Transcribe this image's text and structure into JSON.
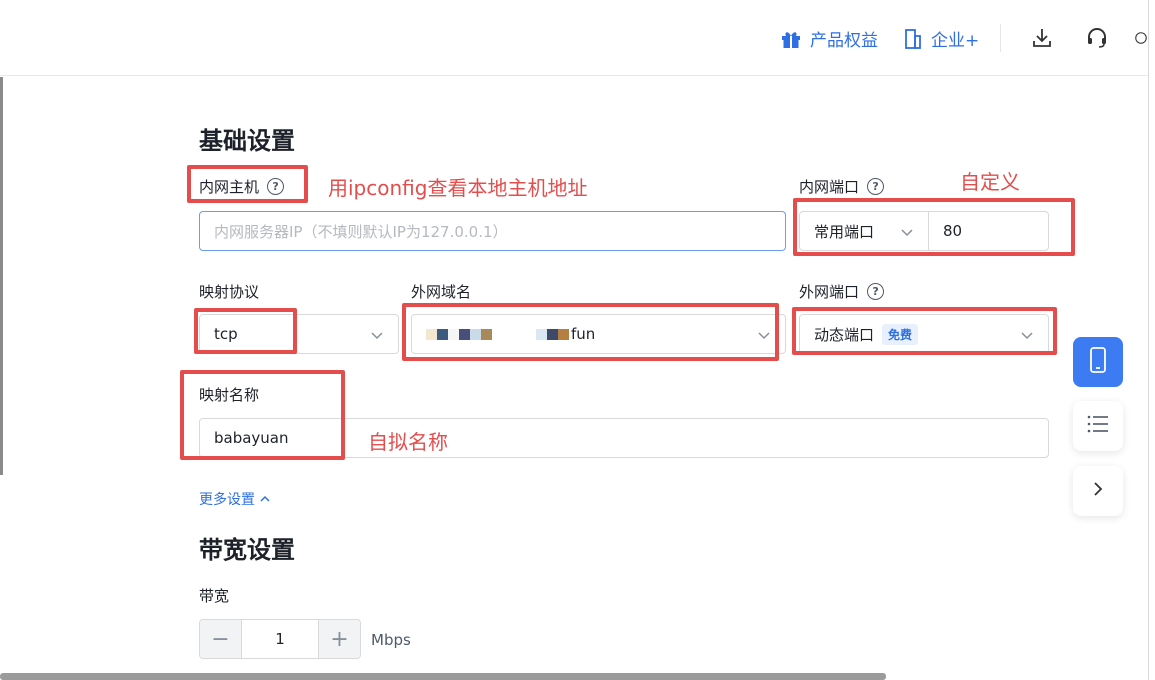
{
  "topbar": {
    "benefits_label": "产品权益",
    "enterprise_label": "企业+"
  },
  "basic": {
    "title": "基础设置",
    "host_label": "内网主机",
    "host_placeholder": "内网服务器IP（不填则默认IP为127.0.0.1）",
    "inner_port_label": "内网端口",
    "inner_port_type": "常用端口",
    "inner_port_value": "80",
    "protocol_label": "映射协议",
    "protocol_value": "tcp",
    "domain_label": "外网域名",
    "domain_suffix": "fun",
    "outer_port_label": "外网端口",
    "outer_port_value": "动态端口",
    "outer_port_badge": "免费",
    "name_label": "映射名称",
    "name_value": "babayuan",
    "more_settings": "更多设置"
  },
  "bandwidth": {
    "title": "带宽设置",
    "label": "带宽",
    "minus": "−",
    "plus": "+",
    "value": "1",
    "unit": "Mbps"
  },
  "annotations": {
    "host_note": "用ipconfig查看本地主机地址",
    "port_note": "自定义",
    "name_note": "自拟名称"
  },
  "colors": {
    "accent": "#2f6fe4",
    "annotation_red": "#e54d4d"
  }
}
